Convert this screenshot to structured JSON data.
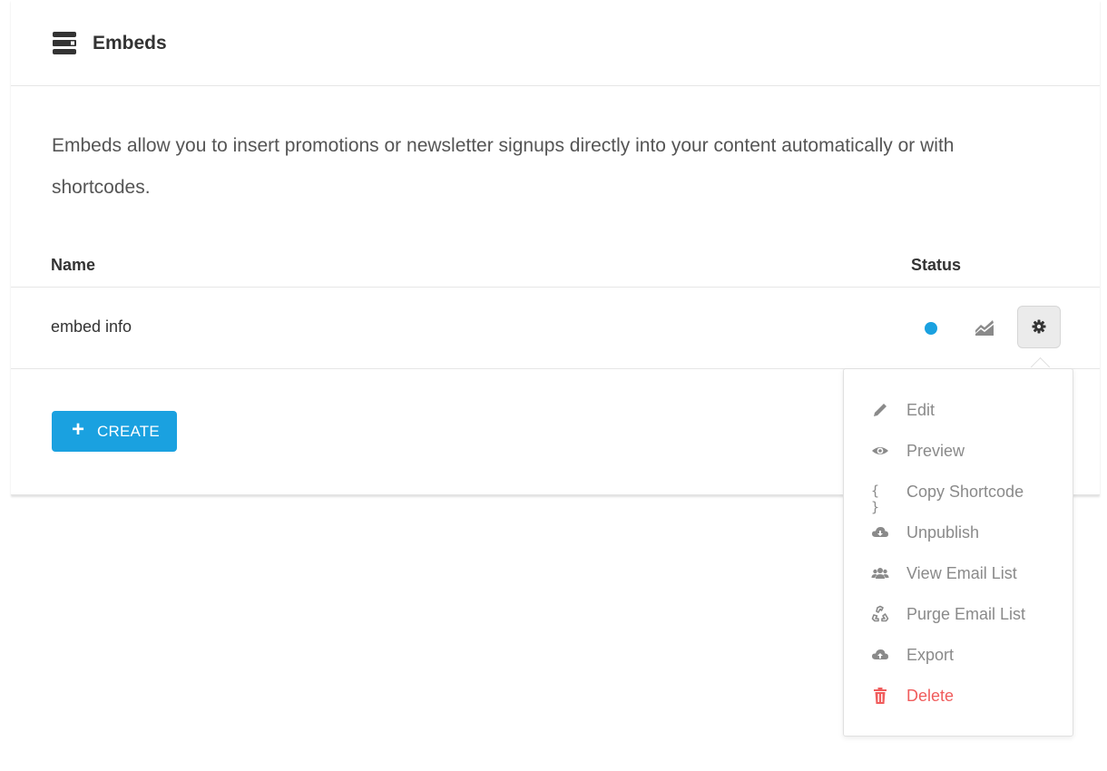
{
  "header": {
    "title": "Embeds",
    "icon": "embed-icon"
  },
  "description": "Embeds allow you to insert promotions or newsletter signups directly into your content automatically or with shortcodes.",
  "table": {
    "columns": {
      "name": "Name",
      "status": "Status"
    },
    "rows": [
      {
        "name": "embed info",
        "status_color": "#1aa1e0"
      }
    ]
  },
  "create_button": {
    "label": "CREATE",
    "icon": "plus-icon",
    "color": "#1aa1e0"
  },
  "menu": {
    "items": [
      {
        "label": "Edit",
        "icon": "pencil-icon"
      },
      {
        "label": "Preview",
        "icon": "eye-icon"
      },
      {
        "label": "Copy Shortcode",
        "icon": "braces-icon"
      },
      {
        "label": "Unpublish",
        "icon": "cloud-download-icon"
      },
      {
        "label": "View Email List",
        "icon": "users-icon"
      },
      {
        "label": "Purge Email List",
        "icon": "recycle-icon"
      },
      {
        "label": "Export",
        "icon": "cloud-upload-icon"
      },
      {
        "label": "Delete",
        "icon": "trash-icon",
        "color": "#f05c5c"
      }
    ]
  }
}
